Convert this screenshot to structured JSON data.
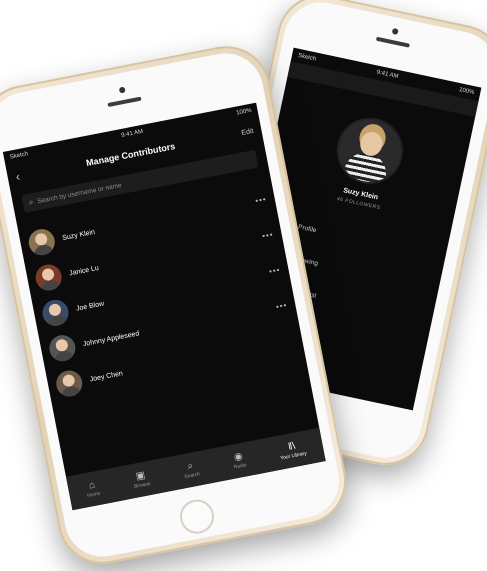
{
  "back_phone": {
    "status": {
      "carrier": "Sketch",
      "time": "9:41 AM",
      "battery": "100%"
    },
    "profile": {
      "name": "Suzy Klein",
      "followers": "46 FOLLOWERS"
    },
    "menu": [
      {
        "icon": "user-icon",
        "label": "View Profile"
      },
      {
        "icon": "close-icon",
        "label": "Stop Following"
      },
      {
        "icon": "remove-icon",
        "label": "lete from Playlist"
      },
      {
        "icon": "more-icon",
        "label": "w"
      }
    ]
  },
  "front_phone": {
    "status": {
      "carrier": "Sketch",
      "time": "9:41 AM",
      "battery": "100%"
    },
    "nav": {
      "back": "‹",
      "title": "Manage Contributors",
      "edit": "Edit"
    },
    "search": {
      "placeholder": "Search by username or name"
    },
    "contributors": [
      {
        "name": "Suzy Klein",
        "avatar_color": "#8a7350"
      },
      {
        "name": "Janice Lu",
        "avatar_color": "#7a3b2a"
      },
      {
        "name": "Joe Blow",
        "avatar_color": "#3a4a6a"
      },
      {
        "name": "Johnny Appleseed",
        "avatar_color": "#555555"
      },
      {
        "name": "Joey Chen",
        "avatar_color": "#6b5a48"
      }
    ],
    "more": "•••",
    "tabs": [
      {
        "icon": "home-icon",
        "glyph": "⌂",
        "label": "Home"
      },
      {
        "icon": "browse-icon",
        "glyph": "▣",
        "label": "Browse"
      },
      {
        "icon": "search-icon",
        "glyph": "⌕",
        "label": "Search"
      },
      {
        "icon": "radio-icon",
        "glyph": "◉",
        "label": "Radio"
      },
      {
        "icon": "library-icon",
        "glyph": "‖\\",
        "label": "Your Library"
      }
    ]
  }
}
